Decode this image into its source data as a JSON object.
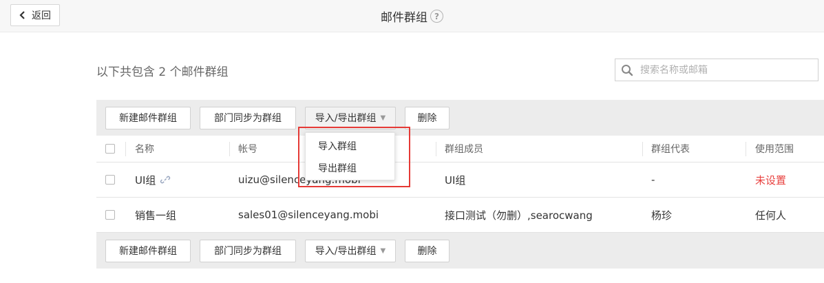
{
  "header": {
    "back_label": "返回",
    "title": "邮件群组",
    "help_icon": "?"
  },
  "summary": {
    "text": "以下共包含 2 个邮件群组"
  },
  "search": {
    "placeholder": "搜索名称或邮箱",
    "value": ""
  },
  "toolbar": {
    "new_group": "新建邮件群组",
    "dept_sync": "部门同步为群组",
    "import_export": "导入/导出群组",
    "caret": "▼",
    "delete": "删除"
  },
  "table": {
    "columns": [
      "名称",
      "帐号",
      "群组成员",
      "群组代表",
      "使用范围"
    ],
    "rows": [
      {
        "name": "UI组",
        "account": "uizu@silenceyang.mobi",
        "members": "UI组",
        "rep": "-",
        "scope": "未设置"
      },
      {
        "name": "销售一组",
        "account": "sales01@silenceyang.mobi",
        "members": "接口测试（勿删）,searocwang",
        "rep": "杨珍",
        "scope": "任何人"
      }
    ]
  },
  "dropdown": {
    "items": [
      "导入群组",
      "导出群组"
    ]
  },
  "colors": {
    "accent_red": "#e8413f",
    "highlight_border": "#e53935",
    "toolbar_bg": "#ececec"
  }
}
